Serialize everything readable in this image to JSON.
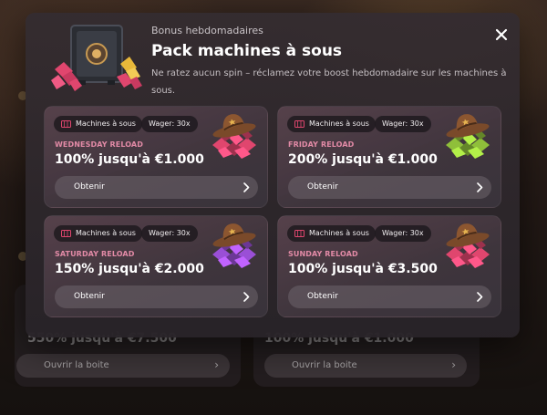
{
  "background": {
    "left_card_title": "550% jusqu'à €7.500",
    "right_card_title": "100% jusqu'à €1.000",
    "left_button": "Ouvrir la boite",
    "right_button": "Ouvrir la boite"
  },
  "modal": {
    "subtitle": "Bonus hebdomadaires",
    "title": "Pack machines à sous",
    "description": "Ne ratez aucun spin – réclamez votre boost hebdomadaire sur les machines à sous.",
    "close_icon": "close-icon"
  },
  "offers": [
    {
      "category": "Machines à sous",
      "wager": "Wager: 30x",
      "reload": "WEDNESDAY RELOAD",
      "title": "100% jusqu'à €1.000",
      "button": "Obtenir",
      "gem_color": "#e0466e"
    },
    {
      "category": "Machines à sous",
      "wager": "Wager: 30x",
      "reload": "FRIDAY RELOAD",
      "title": "200% jusqu'à €1.000",
      "button": "Obtenir",
      "gem_color": "#8fbf3a"
    },
    {
      "category": "Machines à sous",
      "wager": "Wager: 30x",
      "reload": "SATURDAY RELOAD",
      "title": "150% jusqu'à €2.000",
      "button": "Obtenir",
      "gem_color": "#9a4fd6"
    },
    {
      "category": "Machines à sous",
      "wager": "Wager: 30x",
      "reload": "SUNDAY RELOAD",
      "title": "100% jusqu'à €3.500",
      "button": "Obtenir",
      "gem_color": "#e0466e"
    }
  ],
  "colors": {
    "reload_label": "#e28aa6",
    "modal_bg": "#332b30",
    "pill_bg": "#1e1a1e"
  }
}
